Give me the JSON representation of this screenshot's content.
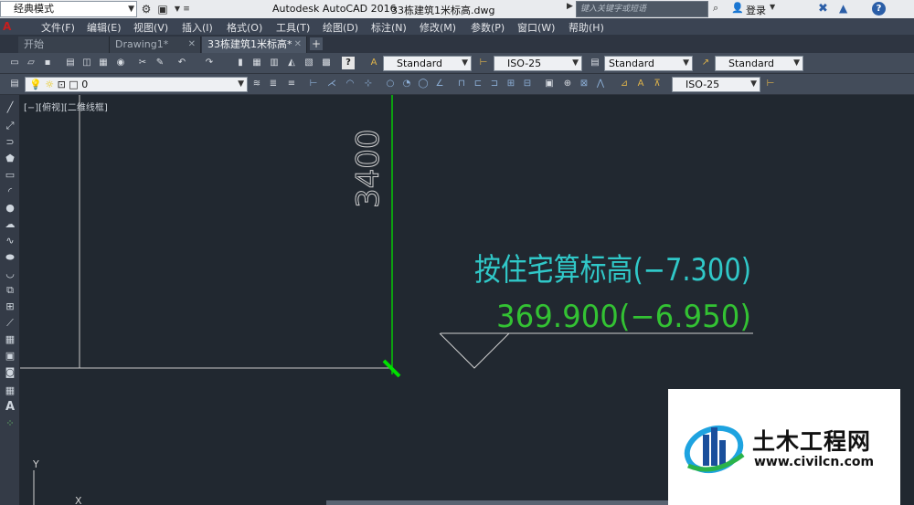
{
  "titlebar": {
    "workspace": "经典模式",
    "app_title": "Autodesk AutoCAD 2016",
    "doc_title": "33栋建筑1米标高.dwg",
    "search_placeholder": "键入关键字或短语",
    "login": "登录"
  },
  "menu": [
    "文件(F)",
    "编辑(E)",
    "视图(V)",
    "插入(I)",
    "格式(O)",
    "工具(T)",
    "绘图(D)",
    "标注(N)",
    "修改(M)",
    "参数(P)",
    "窗口(W)",
    "帮助(H)"
  ],
  "tabs": [
    {
      "label": "开始",
      "active": false,
      "closable": false
    },
    {
      "label": "Drawing1*",
      "active": false,
      "closable": true
    },
    {
      "label": "33栋建筑1米标高*",
      "active": true,
      "closable": true
    }
  ],
  "toolbar1": {
    "text_style": "Standard",
    "dim_style": "ISO-25",
    "table_style": "Standard",
    "mleader_style": "Standard"
  },
  "toolbar2": {
    "layer": "0",
    "dim_style": "ISO-25"
  },
  "canvas": {
    "view_label": "[−][俯视][二维线框]",
    "dimension": "3400",
    "elev_text_1": "按住宅算标高(−7.300)",
    "elev_text_2": "369.900(−6.950)",
    "ucs_y": "Y",
    "ucs_x": "X",
    "colors": {
      "background": "#212830",
      "dim_line": "#00e000",
      "text_cyan": "#30c8c8",
      "text_green": "#33c233",
      "white_line": "#d0d0d0"
    }
  },
  "watermark": {
    "name": "土木工程网",
    "url": "www.civilcn.com"
  }
}
